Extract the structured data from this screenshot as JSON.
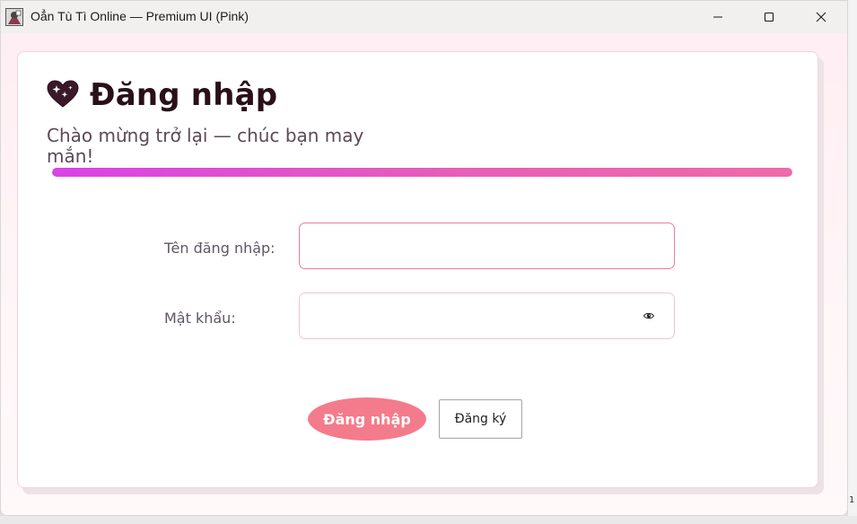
{
  "window": {
    "title": "Oẳn Tù Tì Online — Premium UI (Pink)"
  },
  "login": {
    "heading": "Đăng nhập",
    "subtitle": "Chào mừng trở lại — chúc bạn may mắn!",
    "progress_fraction": 1.0,
    "username_label": "Tên đăng nhập:",
    "username_value": "",
    "password_label": "Mật khẩu:",
    "password_value": "",
    "login_button": "Đăng nhập",
    "register_button": "Đăng ký"
  },
  "backdrop": {
    "edge_text": "1"
  },
  "icons": {
    "heading": "sparkling-heart-icon",
    "password_toggle": "eye-icon",
    "minimize": "minimize-icon",
    "maximize": "maximize-icon",
    "close": "close-icon"
  },
  "colors": {
    "accent_pink": "#f47b8b",
    "progress_start": "#d943e6",
    "progress_end": "#ef6aa8",
    "input_focus_border": "#ea7ba0"
  }
}
